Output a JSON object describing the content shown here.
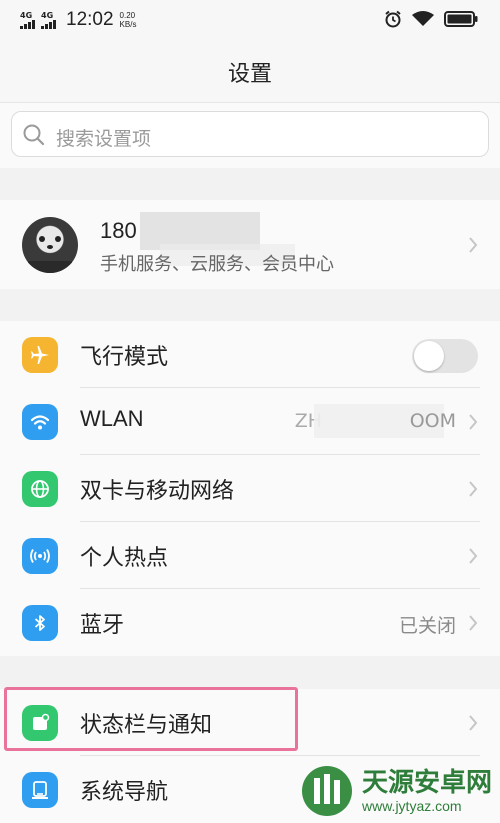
{
  "status_bar": {
    "net1": "4G",
    "net2": "4G",
    "time": "12:02",
    "speed_value": "0.20",
    "speed_unit": "KB/s",
    "icons": [
      "alarm-icon",
      "wifi-icon",
      "battery-icon"
    ]
  },
  "header": {
    "title": "设置"
  },
  "search": {
    "placeholder": "搜索设置项"
  },
  "account": {
    "name_visible": "180",
    "subtitle": "手机服务、云服务、会员中心"
  },
  "group1": [
    {
      "label": "飞行模式",
      "icon": "airplane-icon",
      "icon_color": "#f6b530",
      "control": "toggle",
      "toggle_on": false
    },
    {
      "label": "WLAN",
      "icon": "wifi-icon",
      "icon_color": "#2f9ef0",
      "value_left": "ZH",
      "value_right": "OOM"
    },
    {
      "label": "双卡与移动网络",
      "icon": "globe-icon",
      "icon_color": "#33c870"
    },
    {
      "label": "个人热点",
      "icon": "hotspot-icon",
      "icon_color": "#2f9ef0"
    },
    {
      "label": "蓝牙",
      "icon": "bluetooth-icon",
      "icon_color": "#2f9ef0",
      "value": "已关闭"
    }
  ],
  "group2": [
    {
      "label": "状态栏与通知",
      "icon": "notification-icon",
      "icon_color": "#33c870"
    },
    {
      "label": "系统导航",
      "icon": "navigation-icon",
      "icon_color": "#2f9ef0"
    }
  ],
  "watermark": {
    "title": "天源安卓网",
    "url": "www.jytyaz.com"
  }
}
